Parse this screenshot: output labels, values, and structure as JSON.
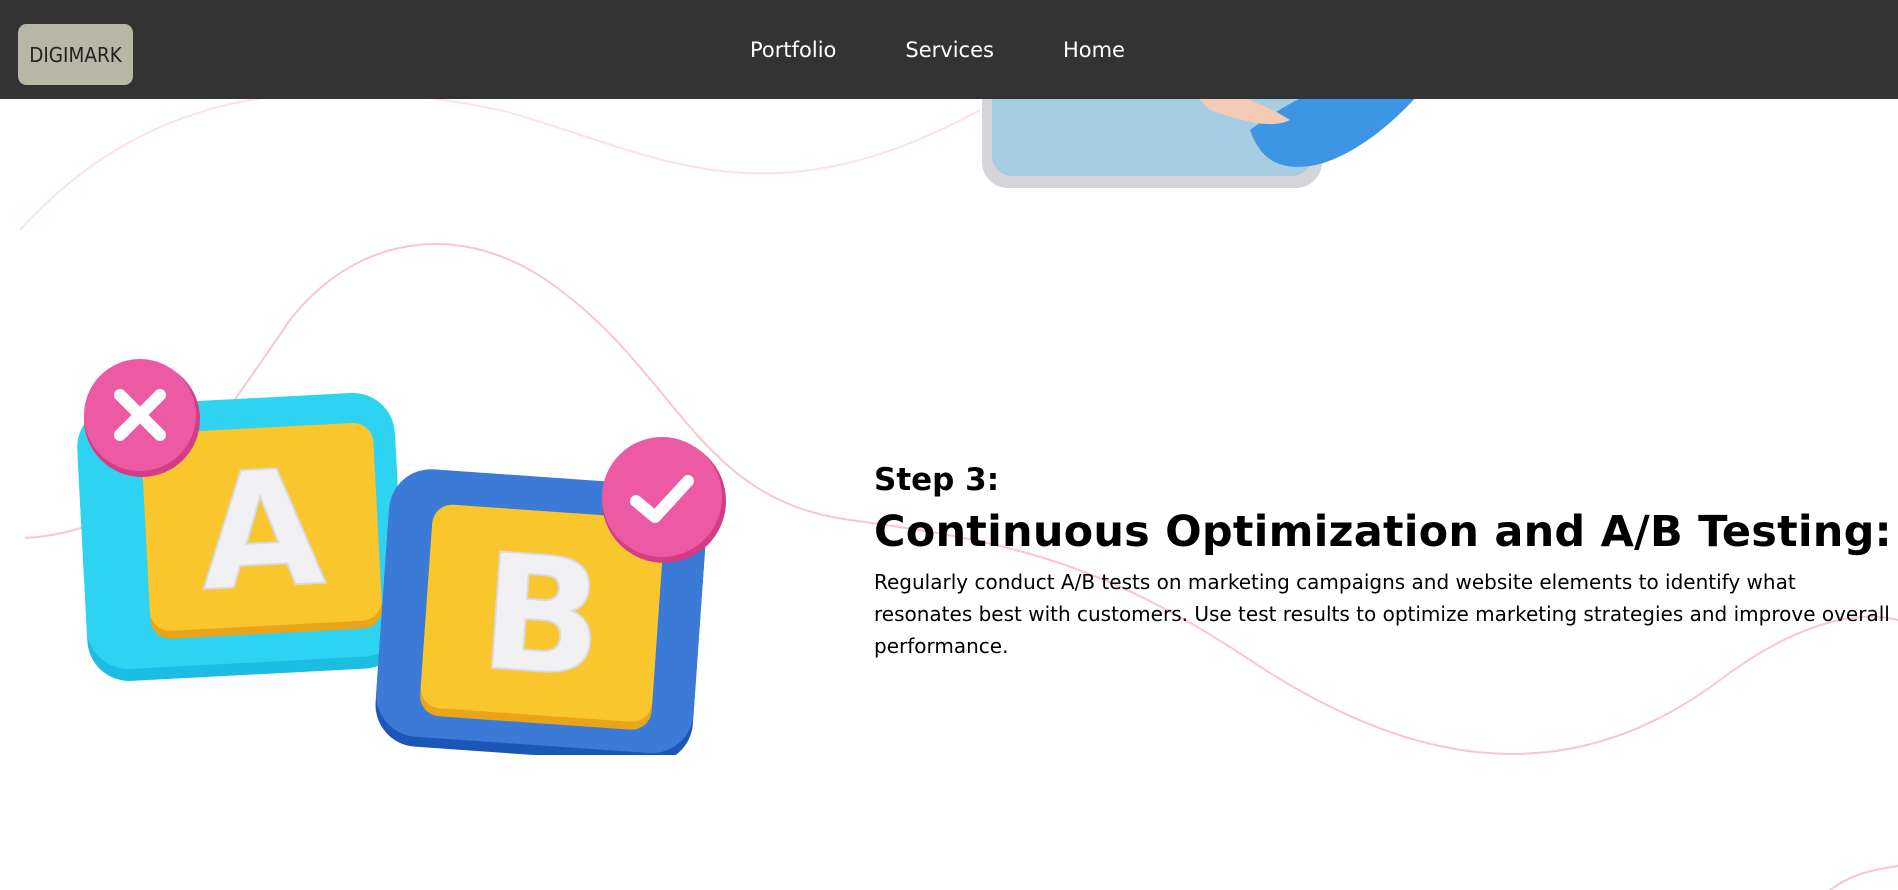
{
  "nav": {
    "logo": "DIGIMARK",
    "links": [
      "Portfolio",
      "Services",
      "Home"
    ]
  },
  "section": {
    "step_label": "Step 3:",
    "title": "Continuous Optimization and A/B Testing:",
    "description": "Regularly conduct A/B tests on marketing campaigns and website elements to identify what resonates best with customers. Use test results to optimize marketing strategies and improve overall performance."
  },
  "illustration": {
    "letter_a": "A",
    "letter_b": "B",
    "icon_left": "close-icon",
    "icon_right": "check-icon"
  },
  "colors": {
    "navbar": "#333333",
    "logo_bg": "#b8b6a4",
    "cyan_block": "#22c8ec",
    "blue_block": "#2f6fd0",
    "yellow_face": "#f7c325",
    "pink_badge": "#ea4f9c",
    "wave_line": "#f7c6d2"
  }
}
